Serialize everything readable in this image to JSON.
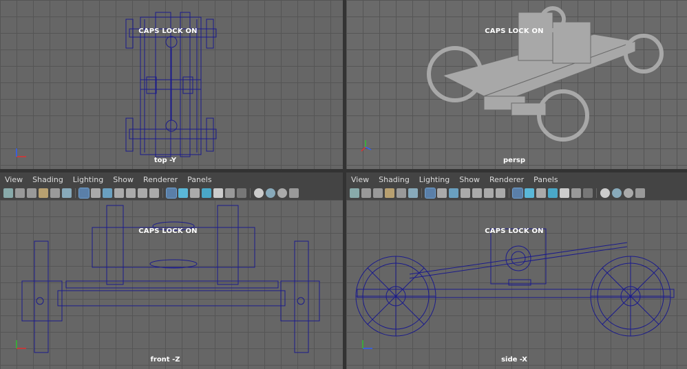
{
  "caps_lock": "CAPS LOCK ON",
  "viewports": {
    "top": {
      "camera": "top -Y"
    },
    "persp": {
      "camera": "persp"
    },
    "front": {
      "camera": "front -Z"
    },
    "side": {
      "camera": "side -X"
    }
  },
  "panel_menu": [
    "View",
    "Shading",
    "Lighting",
    "Show",
    "Renderer",
    "Panels"
  ],
  "axis_labels": {
    "x": "x",
    "y": "y",
    "z": "z"
  },
  "colors": {
    "wire": "#1a1a8c",
    "viewport_bg": "#666666",
    "grid": "#555555",
    "shaded": "#a8a8a8",
    "axis_x": "#e03030",
    "axis_y": "#30c030",
    "axis_z": "#3060ff"
  },
  "toolbar_icons": [
    "camera-select-icon",
    "camera-attr-icon",
    "bookmark-icon",
    "image-plane-icon",
    "2d-pan-icon",
    "grease-pencil-icon",
    "grid-icon",
    "film-gate-icon",
    "resolution-gate-icon",
    "gate-mask-icon",
    "field-chart-icon",
    "safe-action-icon",
    "safe-title-icon",
    "wireframe-icon",
    "smooth-shade-icon",
    "wireframe-on-shaded-icon",
    "textured-icon",
    "use-lights-icon",
    "shadows-icon",
    "xray-icon",
    "xray-joints-icon",
    "xray-components-icon",
    "isolate-icon",
    "high-quality-icon",
    "ambient-occlusion-icon",
    "anti-aliasing-icon",
    "depth-of-field-icon"
  ]
}
